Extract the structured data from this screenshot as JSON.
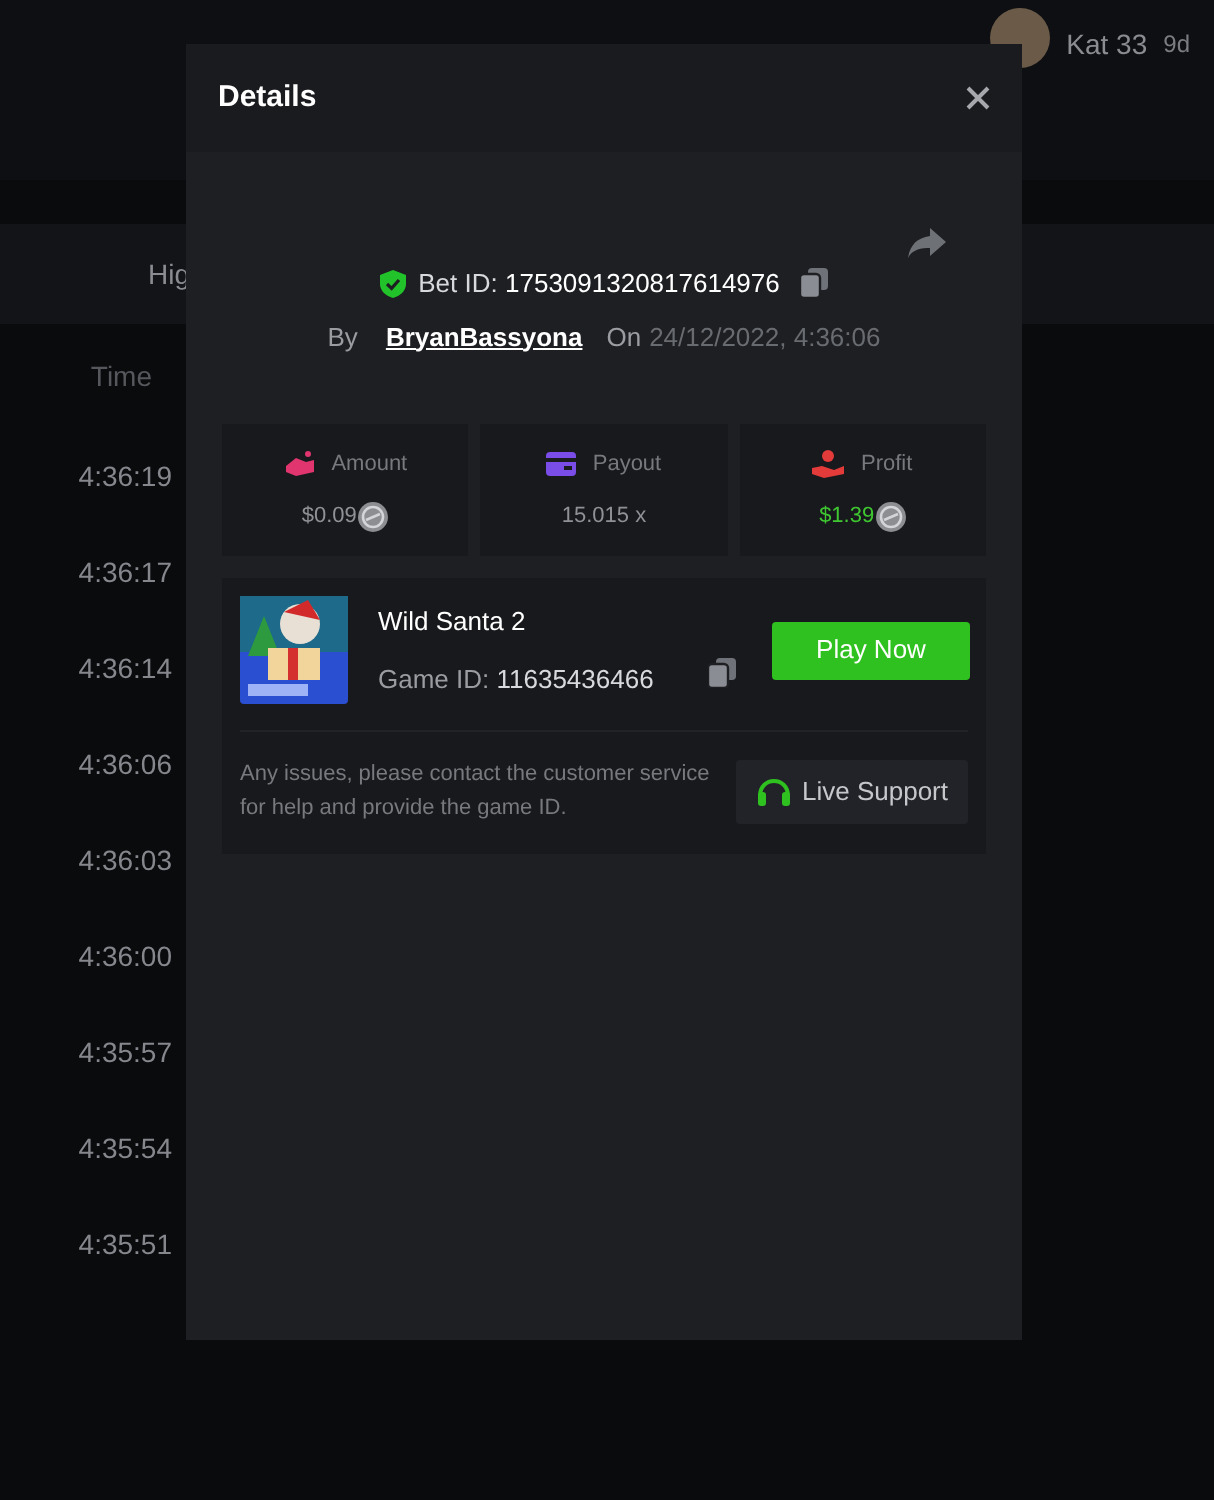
{
  "background": {
    "user": {
      "name": "Kat 33",
      "extra": "9d"
    },
    "tab": "Hig",
    "column": "Time",
    "times": [
      "4:36:19",
      "4:36:17",
      "4:36:14",
      "4:36:06",
      "4:36:03",
      "4:36:00",
      "4:35:57",
      "4:35:54",
      "4:35:51"
    ]
  },
  "modal": {
    "title": "Details",
    "bet_label": "Bet ID:",
    "bet_id": "1753091320817614976",
    "by_label": "By",
    "user": "BryanBassyona",
    "on_label": "On",
    "date": "24/12/2022, 4:36:06",
    "stats": [
      {
        "kind": "amount",
        "label": "Amount",
        "value": "$0.09",
        "coin": true,
        "positive": false
      },
      {
        "kind": "payout",
        "label": "Payout",
        "value": "15.015 x",
        "coin": false,
        "positive": false
      },
      {
        "kind": "profit",
        "label": "Profit",
        "value": "$1.39",
        "coin": true,
        "positive": true
      }
    ],
    "game": {
      "name": "Wild Santa 2",
      "id_label": "Game ID:",
      "id": "11635436466",
      "play": "Play Now",
      "note": "Any issues, please contact the customer service for help and provide the game ID.",
      "support": "Live Support"
    }
  }
}
